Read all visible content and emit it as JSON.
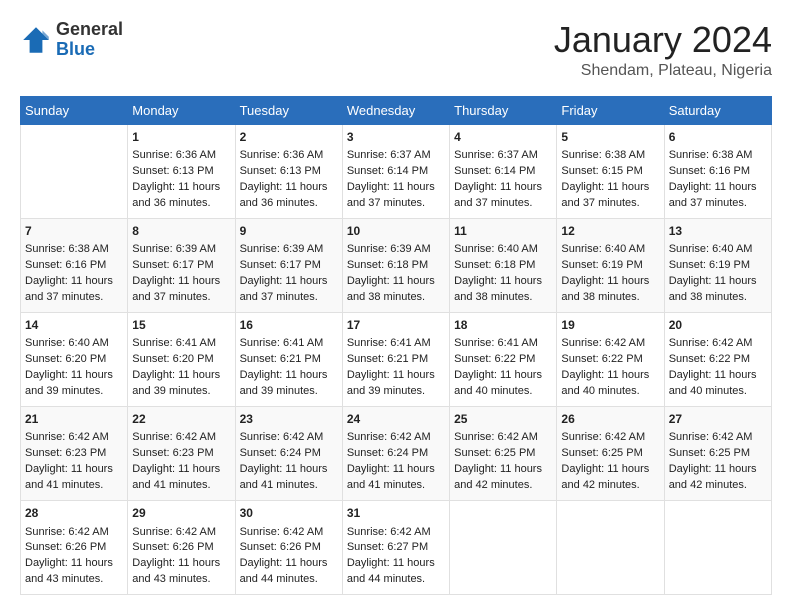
{
  "logo": {
    "general": "General",
    "blue": "Blue"
  },
  "header": {
    "month_year": "January 2024",
    "location": "Shendam, Plateau, Nigeria"
  },
  "days_of_week": [
    "Sunday",
    "Monday",
    "Tuesday",
    "Wednesday",
    "Thursday",
    "Friday",
    "Saturday"
  ],
  "weeks": [
    [
      {
        "day": "",
        "content": ""
      },
      {
        "day": "1",
        "content": "Sunrise: 6:36 AM\nSunset: 6:13 PM\nDaylight: 11 hours\nand 36 minutes."
      },
      {
        "day": "2",
        "content": "Sunrise: 6:36 AM\nSunset: 6:13 PM\nDaylight: 11 hours\nand 36 minutes."
      },
      {
        "day": "3",
        "content": "Sunrise: 6:37 AM\nSunset: 6:14 PM\nDaylight: 11 hours\nand 37 minutes."
      },
      {
        "day": "4",
        "content": "Sunrise: 6:37 AM\nSunset: 6:14 PM\nDaylight: 11 hours\nand 37 minutes."
      },
      {
        "day": "5",
        "content": "Sunrise: 6:38 AM\nSunset: 6:15 PM\nDaylight: 11 hours\nand 37 minutes."
      },
      {
        "day": "6",
        "content": "Sunrise: 6:38 AM\nSunset: 6:16 PM\nDaylight: 11 hours\nand 37 minutes."
      }
    ],
    [
      {
        "day": "7",
        "content": "Sunrise: 6:38 AM\nSunset: 6:16 PM\nDaylight: 11 hours\nand 37 minutes."
      },
      {
        "day": "8",
        "content": "Sunrise: 6:39 AM\nSunset: 6:17 PM\nDaylight: 11 hours\nand 37 minutes."
      },
      {
        "day": "9",
        "content": "Sunrise: 6:39 AM\nSunset: 6:17 PM\nDaylight: 11 hours\nand 37 minutes."
      },
      {
        "day": "10",
        "content": "Sunrise: 6:39 AM\nSunset: 6:18 PM\nDaylight: 11 hours\nand 38 minutes."
      },
      {
        "day": "11",
        "content": "Sunrise: 6:40 AM\nSunset: 6:18 PM\nDaylight: 11 hours\nand 38 minutes."
      },
      {
        "day": "12",
        "content": "Sunrise: 6:40 AM\nSunset: 6:19 PM\nDaylight: 11 hours\nand 38 minutes."
      },
      {
        "day": "13",
        "content": "Sunrise: 6:40 AM\nSunset: 6:19 PM\nDaylight: 11 hours\nand 38 minutes."
      }
    ],
    [
      {
        "day": "14",
        "content": "Sunrise: 6:40 AM\nSunset: 6:20 PM\nDaylight: 11 hours\nand 39 minutes."
      },
      {
        "day": "15",
        "content": "Sunrise: 6:41 AM\nSunset: 6:20 PM\nDaylight: 11 hours\nand 39 minutes."
      },
      {
        "day": "16",
        "content": "Sunrise: 6:41 AM\nSunset: 6:21 PM\nDaylight: 11 hours\nand 39 minutes."
      },
      {
        "day": "17",
        "content": "Sunrise: 6:41 AM\nSunset: 6:21 PM\nDaylight: 11 hours\nand 39 minutes."
      },
      {
        "day": "18",
        "content": "Sunrise: 6:41 AM\nSunset: 6:22 PM\nDaylight: 11 hours\nand 40 minutes."
      },
      {
        "day": "19",
        "content": "Sunrise: 6:42 AM\nSunset: 6:22 PM\nDaylight: 11 hours\nand 40 minutes."
      },
      {
        "day": "20",
        "content": "Sunrise: 6:42 AM\nSunset: 6:22 PM\nDaylight: 11 hours\nand 40 minutes."
      }
    ],
    [
      {
        "day": "21",
        "content": "Sunrise: 6:42 AM\nSunset: 6:23 PM\nDaylight: 11 hours\nand 41 minutes."
      },
      {
        "day": "22",
        "content": "Sunrise: 6:42 AM\nSunset: 6:23 PM\nDaylight: 11 hours\nand 41 minutes."
      },
      {
        "day": "23",
        "content": "Sunrise: 6:42 AM\nSunset: 6:24 PM\nDaylight: 11 hours\nand 41 minutes."
      },
      {
        "day": "24",
        "content": "Sunrise: 6:42 AM\nSunset: 6:24 PM\nDaylight: 11 hours\nand 41 minutes."
      },
      {
        "day": "25",
        "content": "Sunrise: 6:42 AM\nSunset: 6:25 PM\nDaylight: 11 hours\nand 42 minutes."
      },
      {
        "day": "26",
        "content": "Sunrise: 6:42 AM\nSunset: 6:25 PM\nDaylight: 11 hours\nand 42 minutes."
      },
      {
        "day": "27",
        "content": "Sunrise: 6:42 AM\nSunset: 6:25 PM\nDaylight: 11 hours\nand 42 minutes."
      }
    ],
    [
      {
        "day": "28",
        "content": "Sunrise: 6:42 AM\nSunset: 6:26 PM\nDaylight: 11 hours\nand 43 minutes."
      },
      {
        "day": "29",
        "content": "Sunrise: 6:42 AM\nSunset: 6:26 PM\nDaylight: 11 hours\nand 43 minutes."
      },
      {
        "day": "30",
        "content": "Sunrise: 6:42 AM\nSunset: 6:26 PM\nDaylight: 11 hours\nand 44 minutes."
      },
      {
        "day": "31",
        "content": "Sunrise: 6:42 AM\nSunset: 6:27 PM\nDaylight: 11 hours\nand 44 minutes."
      },
      {
        "day": "",
        "content": ""
      },
      {
        "day": "",
        "content": ""
      },
      {
        "day": "",
        "content": ""
      }
    ]
  ]
}
